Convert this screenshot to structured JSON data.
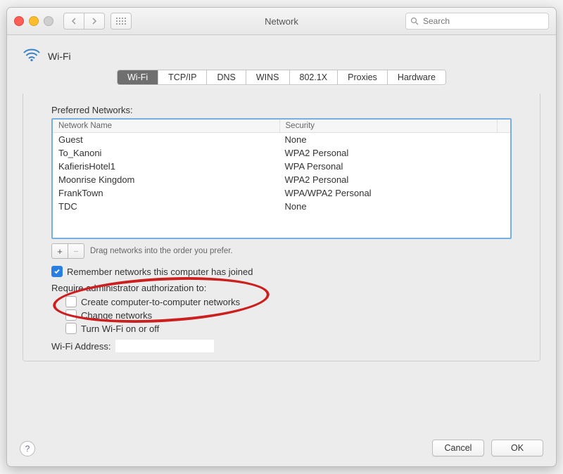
{
  "window": {
    "title": "Network",
    "search_placeholder": "Search"
  },
  "header": {
    "icon": "wifi-icon",
    "label": "Wi-Fi"
  },
  "tabs": [
    "Wi-Fi",
    "TCP/IP",
    "DNS",
    "WINS",
    "802.1X",
    "Proxies",
    "Hardware"
  ],
  "active_tab": "Wi-Fi",
  "preferred": {
    "label": "Preferred Networks:",
    "columns": {
      "name": "Network Name",
      "security": "Security"
    },
    "rows": [
      {
        "name": "Guest",
        "security": "None"
      },
      {
        "name": "To_Kanoni",
        "security": "WPA2 Personal"
      },
      {
        "name": "KafierisHotel1",
        "security": "WPA Personal"
      },
      {
        "name": "Moonrise Kingdom",
        "security": "WPA2 Personal"
      },
      {
        "name": "FrankTown",
        "security": "WPA/WPA2 Personal"
      },
      {
        "name": "TDC",
        "security": "None"
      }
    ],
    "hint": "Drag networks into the order you prefer."
  },
  "remember": {
    "label": "Remember networks this computer has joined",
    "checked": true
  },
  "auth": {
    "label": "Require administrator authorization to:",
    "options": [
      {
        "label": "Create computer-to-computer networks",
        "checked": false
      },
      {
        "label": "Change networks",
        "checked": false
      },
      {
        "label": "Turn Wi-Fi on or off",
        "checked": false
      }
    ]
  },
  "address": {
    "label": "Wi-Fi Address:",
    "value": ""
  },
  "buttons": {
    "cancel": "Cancel",
    "ok": "OK"
  },
  "glyphs": {
    "plus": "+",
    "minus": "−",
    "help": "?"
  }
}
